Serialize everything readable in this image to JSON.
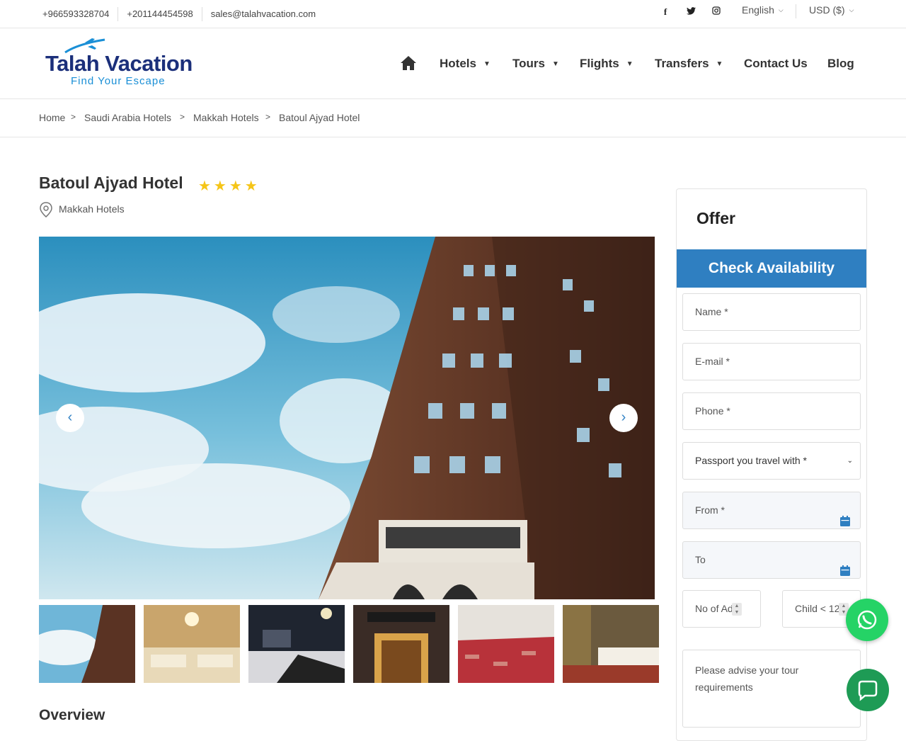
{
  "topbar": {
    "phone1": "+966593328704",
    "phone2": "+201144454598",
    "email": "sales@talahvacation.com",
    "social_icons": [
      "facebook-icon",
      "twitter-icon",
      "instagram-icon"
    ],
    "language": "English",
    "currency": "USD ($)"
  },
  "logo": {
    "brand": "Talah Vacation",
    "tagline": "Find Your Escape"
  },
  "nav": {
    "home_icon": "home-icon",
    "items": [
      {
        "label": "Hotels",
        "dropdown": true
      },
      {
        "label": "Tours",
        "dropdown": true
      },
      {
        "label": "Flights",
        "dropdown": true
      },
      {
        "label": "Transfers",
        "dropdown": true
      },
      {
        "label": "Contact Us",
        "dropdown": false
      },
      {
        "label": "Blog",
        "dropdown": false
      }
    ]
  },
  "breadcrumb": [
    "Home",
    "Saudi Arabia Hotels",
    "Makkah Hotels",
    "Batoul Ajyad Hotel"
  ],
  "hotel": {
    "name": "Batoul Ajyad Hotel",
    "stars": 4,
    "stars_text": "★★★★",
    "location": "Makkah Hotels"
  },
  "gallery": {
    "prev_icon": "chevron-left-icon",
    "next_icon": "chevron-right-icon",
    "thumbnail_count": 6
  },
  "overview": {
    "heading": "Overview"
  },
  "sidebar": {
    "offer": "Offer",
    "check_title": "Check Availability",
    "name_placeholder": "Name *",
    "email_placeholder": "E-mail *",
    "phone_placeholder": "Phone *",
    "passport_selected": "Passport you travel with *",
    "from_placeholder": "From *",
    "to_placeholder": "To",
    "adults_placeholder": "No of Ad",
    "child_placeholder": "Child < 12",
    "requirements_placeholder": "Please advise your tour requirements"
  },
  "floating": {
    "whatsapp_icon": "whatsapp-icon",
    "chat_icon": "chat-icon"
  },
  "colors": {
    "primary": "#2f7fc1",
    "star": "#f5c518",
    "whatsapp": "#25d366",
    "chat": "#1e9b55",
    "logo_navy": "#1b2f7a",
    "logo_blue": "#1a8fd6"
  }
}
